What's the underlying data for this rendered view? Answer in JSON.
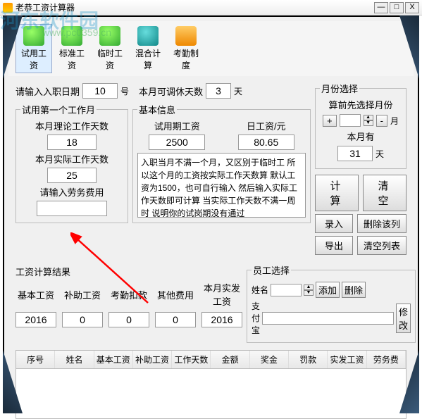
{
  "window": {
    "title": "老恭工资计算器"
  },
  "watermark": {
    "main": "河东软件园",
    "sub": "www.pc0359.cn"
  },
  "winbtns": {
    "min": "—",
    "max": "□",
    "close": "X"
  },
  "toolbar": [
    {
      "label": "试用工资",
      "active": true,
      "icon": "ic-green"
    },
    {
      "label": "标准工资",
      "icon": "ic-green"
    },
    {
      "label": "临时工资",
      "icon": "ic-green"
    },
    {
      "label": "混合计算",
      "icon": "ic-teal"
    },
    {
      "label": "考勤制度",
      "icon": "ic-orange"
    }
  ],
  "top": {
    "label1": "请输入入职日期",
    "val1": "10",
    "unit1": "号",
    "label2": "本月可调休天数",
    "val2": "3",
    "unit2": "天"
  },
  "firstMonth": {
    "legend": "试用第一个工作月",
    "l1": "本月理论工作天数",
    "v1": "18",
    "l2": "本月实际工作天数",
    "v2": "25",
    "l3": "请输入劳务费用"
  },
  "basic": {
    "legend": "基本信息",
    "l1": "试用期工资",
    "v1": "2500",
    "l2": "日工资/元",
    "v2": "80.65",
    "info": "入职当月不满一个月，又区别于临时工\n所以这个月的工资按实际工作天数算\n默认工资为1500，也可自行输入\n然后输入实际工作天数即可计算\n当实际工作天数不满一周时\n说明你的试岗期没有通过"
  },
  "month": {
    "legend": "月份选择",
    "tip": "算前先选择月份",
    "plus": "+",
    "minus": "-",
    "unit": "月",
    "l1": "本月有",
    "v1": "31",
    "u1": "天"
  },
  "actions": {
    "calc": "计 算",
    "clear": "清 空",
    "in": "录入",
    "del": "删除该列",
    "out": "导出",
    "clrList": "清空列表"
  },
  "result": {
    "title": "工资计算结果",
    "cols": [
      "基本工资",
      "补助工资",
      "考勤扣款",
      "其他费用",
      "本月实发工资"
    ],
    "vals": [
      "2016",
      "0",
      "0",
      "0",
      "2016"
    ]
  },
  "emp": {
    "legend": "员工选择",
    "l1": "姓名",
    "add": "添加",
    "del": "删除",
    "l2": "支付宝",
    "mod": "修改"
  },
  "table": {
    "headers": [
      "序号",
      "姓名",
      "基本工资",
      "补助工资",
      "工作天数",
      "金额",
      "奖金",
      "罚款",
      "实发工资",
      "劳务费"
    ]
  }
}
